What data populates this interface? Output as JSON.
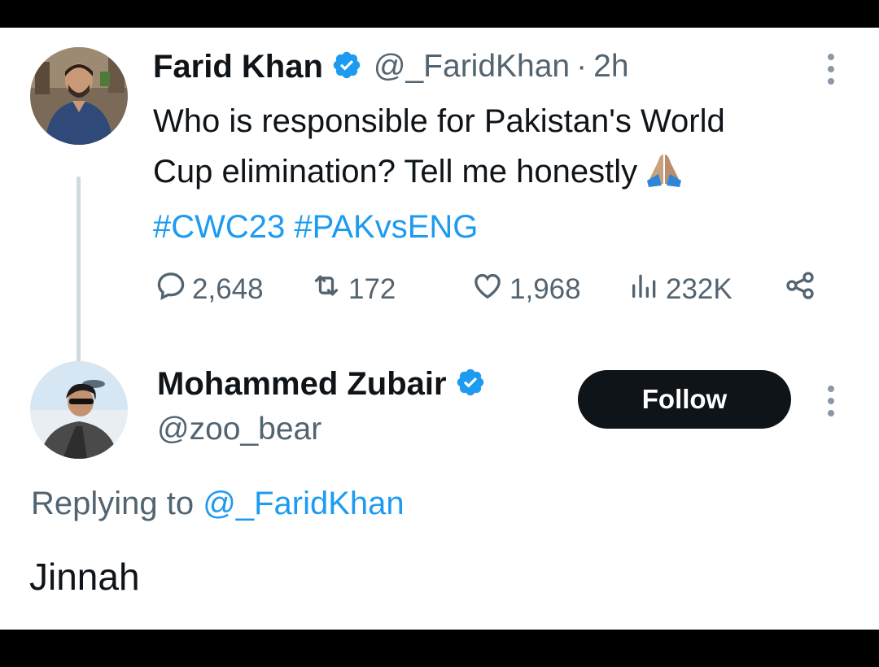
{
  "tweet": {
    "author_name": "Farid Khan",
    "handle": "@_FaridKhan",
    "separator": "·",
    "time": "2h",
    "text_line1": "Who is responsible for Pakistan's World",
    "text_line2": "Cup elimination? Tell me honestly",
    "emoji": "folded-hands",
    "hashtag1": "#CWC23",
    "hashtag2": "#PAKvsENG",
    "stats": {
      "replies": "2,648",
      "retweets": "172",
      "likes": "1,968",
      "views": "232K"
    }
  },
  "reply": {
    "author_name": "Mohammed Zubair",
    "handle": "@zoo_bear",
    "follow_label": "Follow",
    "replying_prefix": "Replying to",
    "replying_to": "@_FaridKhan",
    "text": "Jinnah"
  },
  "colors": {
    "accent": "#1d9bf0",
    "text": "#0f1419",
    "muted": "#536471",
    "follow_bg": "#0f1419",
    "verified": "#1d9bf0"
  },
  "icons": {
    "reply": "comment-icon",
    "retweet": "retweet-icon",
    "like": "heart-icon",
    "views": "bar-chart-icon",
    "share": "share-icon",
    "more": "more-vertical-icon",
    "verified": "verified-badge-icon"
  }
}
